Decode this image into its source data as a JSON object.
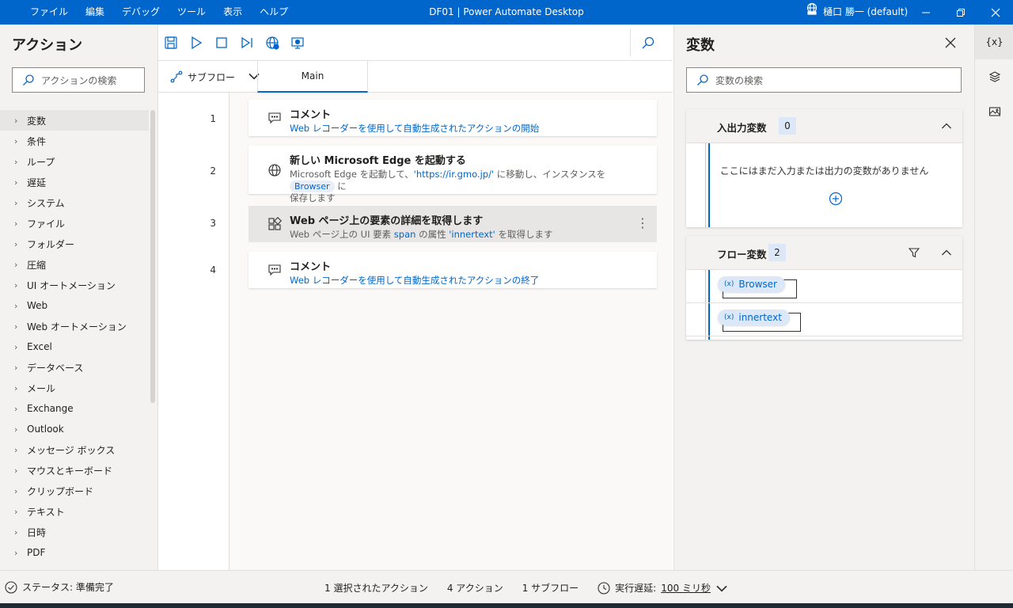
{
  "titlebar": {
    "menu": [
      "ファイル",
      "編集",
      "デバッグ",
      "ツール",
      "表示",
      "ヘルプ"
    ],
    "title": "DF01 | Power Automate Desktop",
    "user": "樋口 勝一 (default)"
  },
  "actions": {
    "title": "アクション",
    "search_placeholder": "アクションの検索",
    "categories": [
      "変数",
      "条件",
      "ループ",
      "遅延",
      "システム",
      "ファイル",
      "フォルダー",
      "圧縮",
      "UI オートメーション",
      "Web",
      "Web オートメーション",
      "Excel",
      "データベース",
      "メール",
      "Exchange",
      "Outlook",
      "メッセージ ボックス",
      "マウスとキーボード",
      "クリップボード",
      "テキスト",
      "日時",
      "PDF"
    ]
  },
  "tabs": {
    "subflow": "サブフロー",
    "main": "Main"
  },
  "steps": [
    {
      "num": "1",
      "title": "コメント",
      "desc": "Web レコーダーを使用して自動生成されたアクションの開始"
    },
    {
      "num": "2",
      "title": "新しい Microsoft Edge を起動する",
      "desc_pre": "Microsoft Edge を起動して、",
      "desc_url": "'https://ir.gmo.jp/'",
      "desc_mid": " に移動し、インスタンスを ",
      "desc_var": "Browser",
      "desc_post": " に",
      "desc_line2": "保存します"
    },
    {
      "num": "3",
      "title": "Web ページ上の要素の詳細を取得します",
      "desc_pre": "Web ページ上の UI 要素 ",
      "desc_elem": "span",
      "desc_mid": " の属性 ",
      "desc_attr": "'innertext'",
      "desc_post": " を取得します"
    },
    {
      "num": "4",
      "title": "コメント",
      "desc": "Web レコーダーを使用して自動生成されたアクションの終了"
    }
  ],
  "variables": {
    "title": "変数",
    "search_placeholder": "変数の検索",
    "io_title": "入出力変数",
    "io_count": "0",
    "io_empty": "ここにはまだ入力または出力の変数がありません",
    "flow_title": "フロー変数",
    "flow_count": "2",
    "flow_vars": [
      "Browser",
      "innertext"
    ],
    "var_prefix": "(x)"
  },
  "strip": {
    "vars_label": "{x}"
  },
  "status": {
    "state": "ステータス: 準備完了",
    "selected": "1 選択されたアクション",
    "actions": "4 アクション",
    "subflows": "1 サブフロー",
    "delay_label": "実行遅延:",
    "delay_value": "100 ミリ秒"
  }
}
